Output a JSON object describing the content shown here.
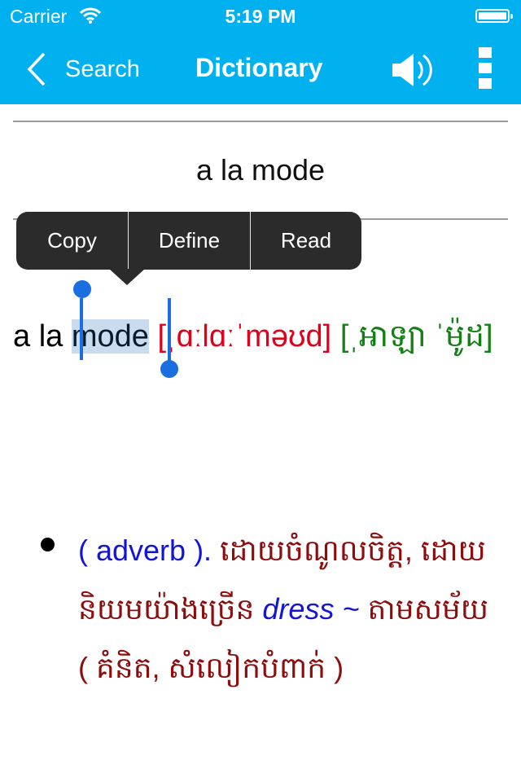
{
  "status_bar": {
    "carrier": "Carrier",
    "time": "5:19 PM",
    "wifi_icon": "wifi-icon",
    "battery_icon": "battery-full-icon"
  },
  "nav_bar": {
    "back_label": "Search",
    "back_icon": "chevron-left-icon",
    "title": "Dictionary",
    "speaker_icon": "speaker-icon",
    "more_icon": "vertical-menu-icon",
    "background_color": "#00b0ef"
  },
  "headword": "a la mode",
  "context_menu": {
    "items": [
      {
        "label": "Copy"
      },
      {
        "label": "Define"
      },
      {
        "label": "Read"
      }
    ]
  },
  "entry": {
    "word_prefix": "a la",
    "selected_word": "mode",
    "ipa": "[ˌɑːlɑːˈməʊd]",
    "khmer_pronunciation": "[ˌអាឡា ˈម៉ូដ]",
    "ipa_color": "#e0001a",
    "khmer_pronunciation_color": "#138013",
    "selection_color": "#c9dbee"
  },
  "definitions": [
    {
      "part_of_speech": "( adverb ).",
      "meaning_1": "ដោយចំណូលចិត្ត, ដោយនិយមយ៉ាងច្រើន",
      "example": "dress ~",
      "meaning_2": "តាមសម័យ ( គំនិត, សំលៀកបំពាក់ )",
      "pos_color": "#1414d6",
      "meaning_color": "#8b0d0d"
    }
  ]
}
